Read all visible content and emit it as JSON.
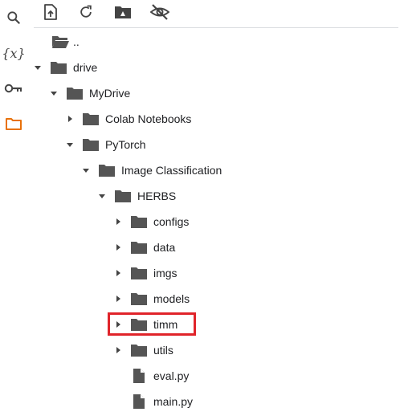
{
  "rail": {
    "items": [
      {
        "name": "search-icon"
      },
      {
        "name": "variables-icon",
        "glyph": "{x}"
      },
      {
        "name": "key-icon"
      },
      {
        "name": "folder-icon",
        "active": true
      }
    ],
    "accent_color": "#e8710a"
  },
  "toolbar": {
    "buttons": [
      "upload-file-icon",
      "refresh-icon",
      "mount-drive-icon",
      "hide-hidden-files-icon"
    ]
  },
  "tree": {
    "parent_label": "..",
    "items": [
      {
        "label": "drive",
        "type": "folder",
        "expanded": true
      },
      {
        "label": "MyDrive",
        "type": "folder",
        "expanded": true
      },
      {
        "label": "Colab Notebooks",
        "type": "folder",
        "expanded": false
      },
      {
        "label": "PyTorch",
        "type": "folder",
        "expanded": true
      },
      {
        "label": "Image Classification",
        "type": "folder",
        "expanded": true
      },
      {
        "label": "HERBS",
        "type": "folder",
        "expanded": true
      },
      {
        "label": "configs",
        "type": "folder",
        "expanded": false
      },
      {
        "label": "data",
        "type": "folder",
        "expanded": false
      },
      {
        "label": "imgs",
        "type": "folder",
        "expanded": false
      },
      {
        "label": "models",
        "type": "folder",
        "expanded": false
      },
      {
        "label": "timm",
        "type": "folder",
        "expanded": false,
        "highlighted": true
      },
      {
        "label": "utils",
        "type": "folder",
        "expanded": false
      },
      {
        "label": "eval.py",
        "type": "file"
      },
      {
        "label": "main.py",
        "type": "file"
      }
    ],
    "highlight_color": "#e0242a"
  }
}
